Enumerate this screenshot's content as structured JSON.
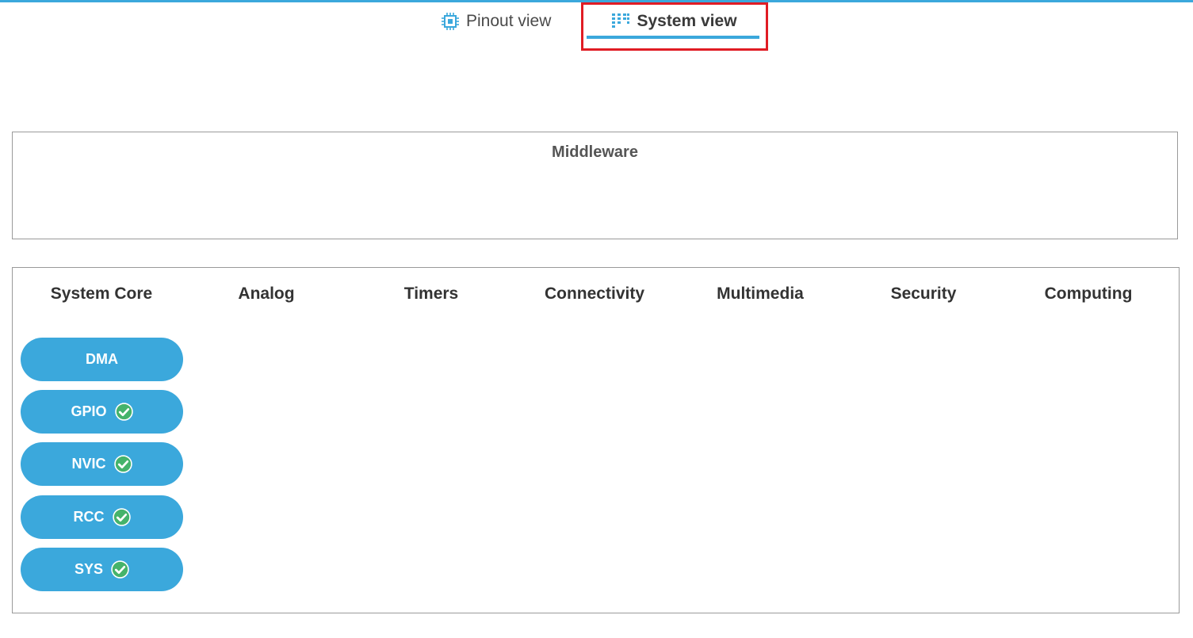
{
  "tabs": {
    "pinout_label": "Pinout view",
    "system_label": "System view"
  },
  "middleware": {
    "title": "Middleware"
  },
  "categories": [
    "System Core",
    "Analog",
    "Timers",
    "Connectivity",
    "Multimedia",
    "Security",
    "Computing"
  ],
  "system_core_items": [
    {
      "label": "DMA",
      "configured": false
    },
    {
      "label": "GPIO",
      "configured": true
    },
    {
      "label": "NVIC",
      "configured": true
    },
    {
      "label": "RCC",
      "configured": true
    },
    {
      "label": "SYS",
      "configured": true
    }
  ],
  "colors": {
    "accent": "#3ba8dc",
    "highlight": "#e01c24",
    "check": "#45b36b"
  },
  "icons": {
    "pinout_tab": "chip-icon",
    "system_tab": "system-view-icon",
    "configured": "check-circle-icon"
  }
}
